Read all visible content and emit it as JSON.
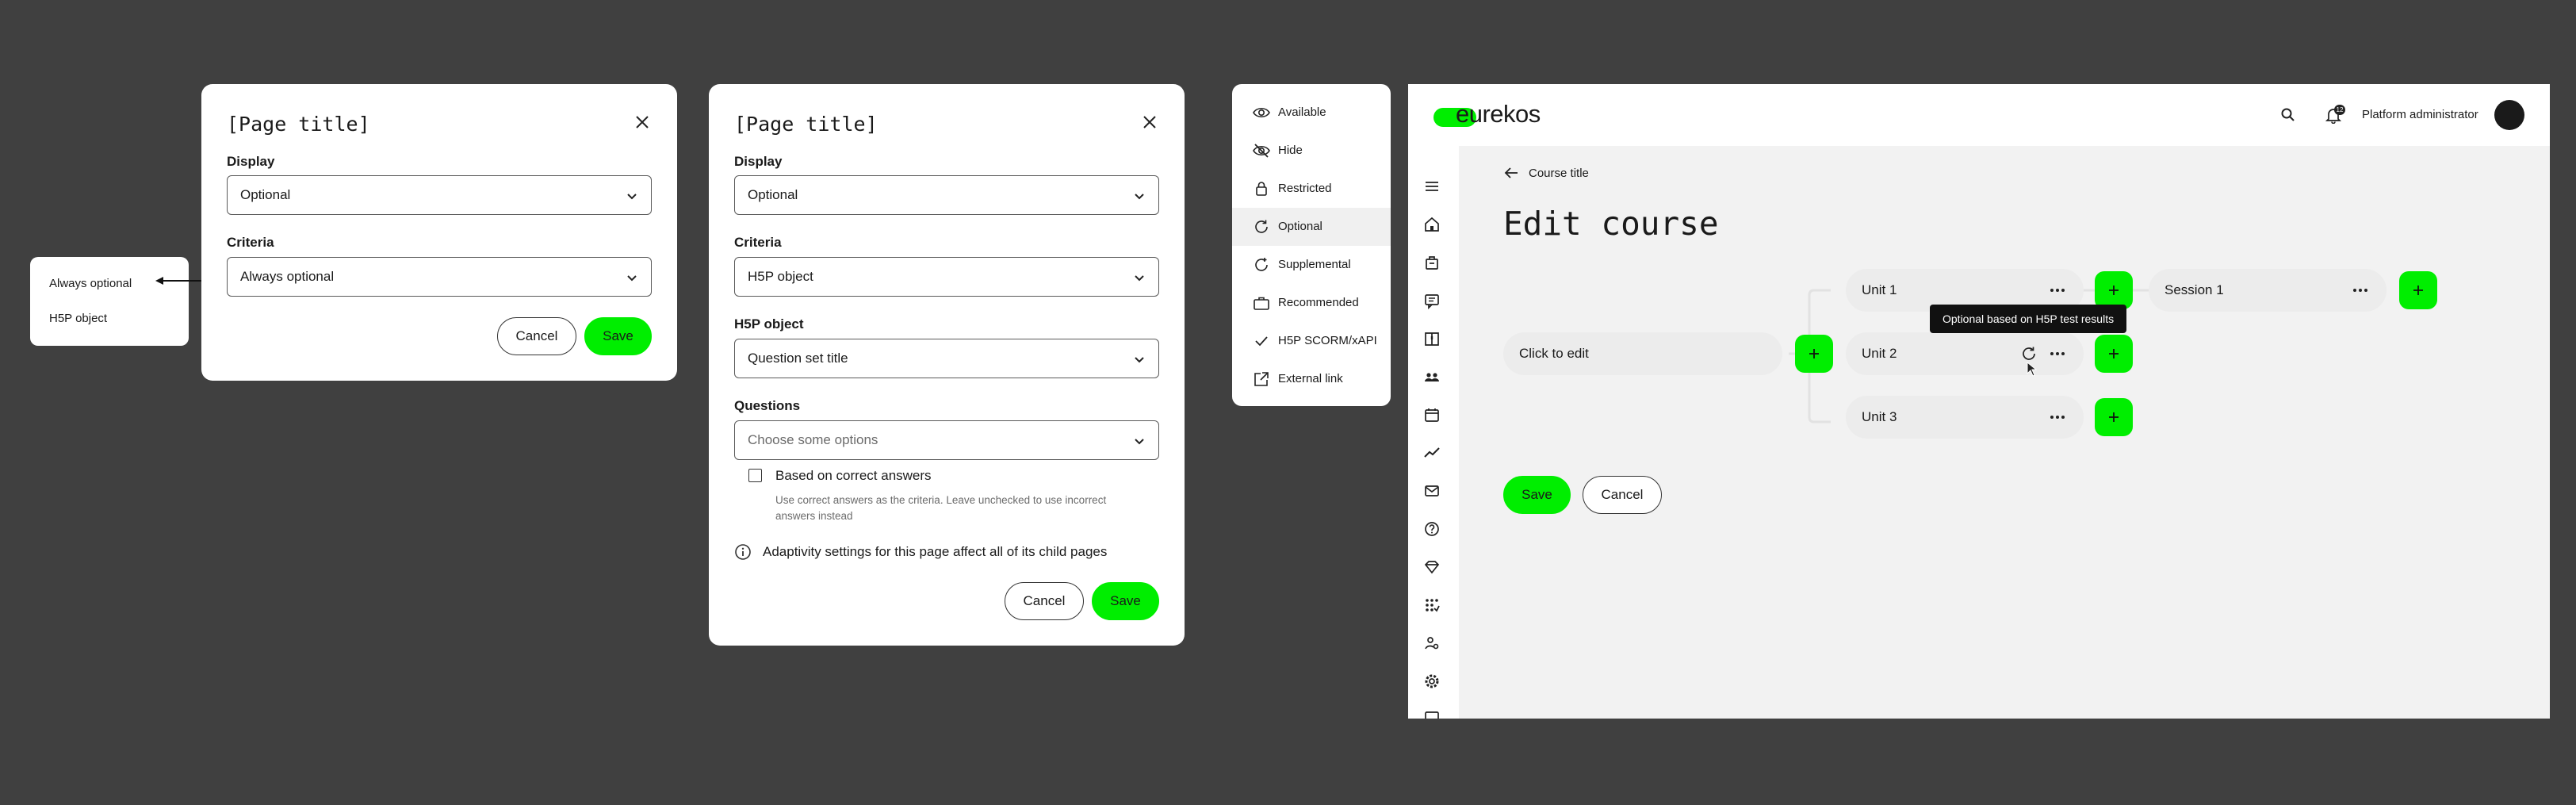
{
  "dialog1": {
    "title": "[Page title]",
    "display_label": "Display",
    "display_value": "Optional",
    "criteria_label": "Criteria",
    "criteria_value": "Always optional",
    "cancel": "Cancel",
    "save": "Save"
  },
  "criteria_popup": {
    "options": [
      "Always optional",
      "H5P object"
    ]
  },
  "dialog2": {
    "title": "[Page title]",
    "display_label": "Display",
    "display_value": "Optional",
    "criteria_label": "Criteria",
    "criteria_value": "H5P object",
    "h5p_label": "H5P object",
    "h5p_value": "Question set title",
    "questions_label": "Questions",
    "questions_placeholder": "Choose some options",
    "checkbox_label": "Based on correct answers",
    "checkbox_help": [
      "Use correct answers as the criteria. Leave unchecked to use incorrect",
      "answers instead"
    ],
    "info_text": "Adaptivity settings for this page affect all of its child pages",
    "cancel": "Cancel",
    "save": "Save"
  },
  "availability_menu": {
    "items": [
      {
        "label": "Available",
        "icon": "eye-icon"
      },
      {
        "label": "Hide",
        "icon": "eye-off-icon"
      },
      {
        "label": "Restricted",
        "icon": "lock-icon"
      },
      {
        "label": "Optional",
        "icon": "refresh-icon"
      },
      {
        "label": "Supplemental",
        "icon": "supplemental-icon"
      },
      {
        "label": "Recommended",
        "icon": "briefcase-icon"
      },
      {
        "label": "H5P SCORM/xAPI",
        "icon": "check-icon"
      },
      {
        "label": "External link",
        "icon": "external-link-icon"
      }
    ],
    "active_index": 3
  },
  "app": {
    "logo_text": "eurekos",
    "notification_count": "12",
    "user_role": "Platform administrator",
    "breadcrumb": "Course title",
    "page_title": "Edit course",
    "root_node": "Click to edit",
    "units": [
      "Unit 1",
      "Unit 2",
      "Unit 3"
    ],
    "session": "Session 1",
    "tooltip": "Optional based on H5P test results",
    "save": "Save",
    "cancel": "Cancel",
    "accent_color": "#00ee00"
  }
}
